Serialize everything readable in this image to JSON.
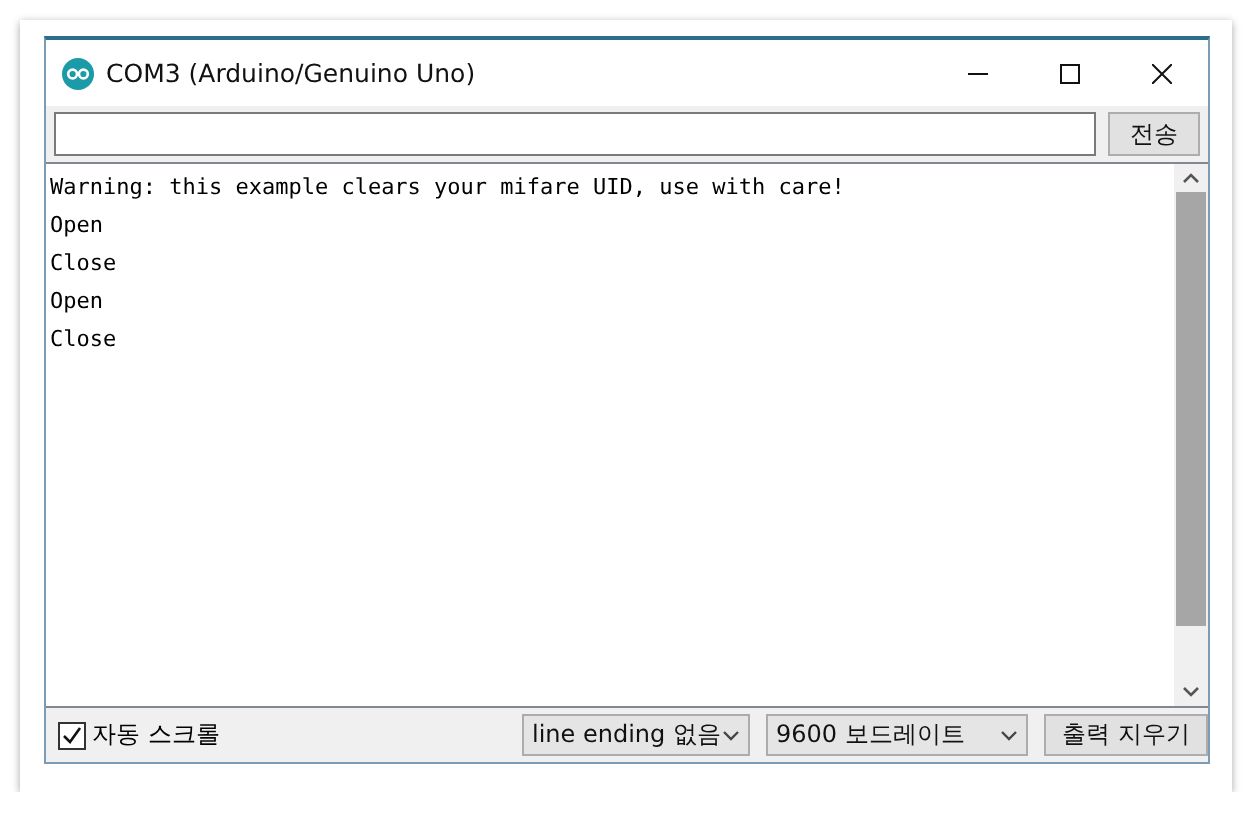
{
  "window": {
    "title": "COM3 (Arduino/Genuino Uno)"
  },
  "send": {
    "button": "전송"
  },
  "output": [
    "Warning: this example clears your mifare UID, use with care!",
    "Open",
    "Close",
    "Open",
    "Close"
  ],
  "footer": {
    "autoscroll": {
      "label": "자동 스크롤",
      "checked": true
    },
    "line_ending": "line ending 없음",
    "baud": "9600 보드레이트",
    "clear": "출력 지우기"
  }
}
